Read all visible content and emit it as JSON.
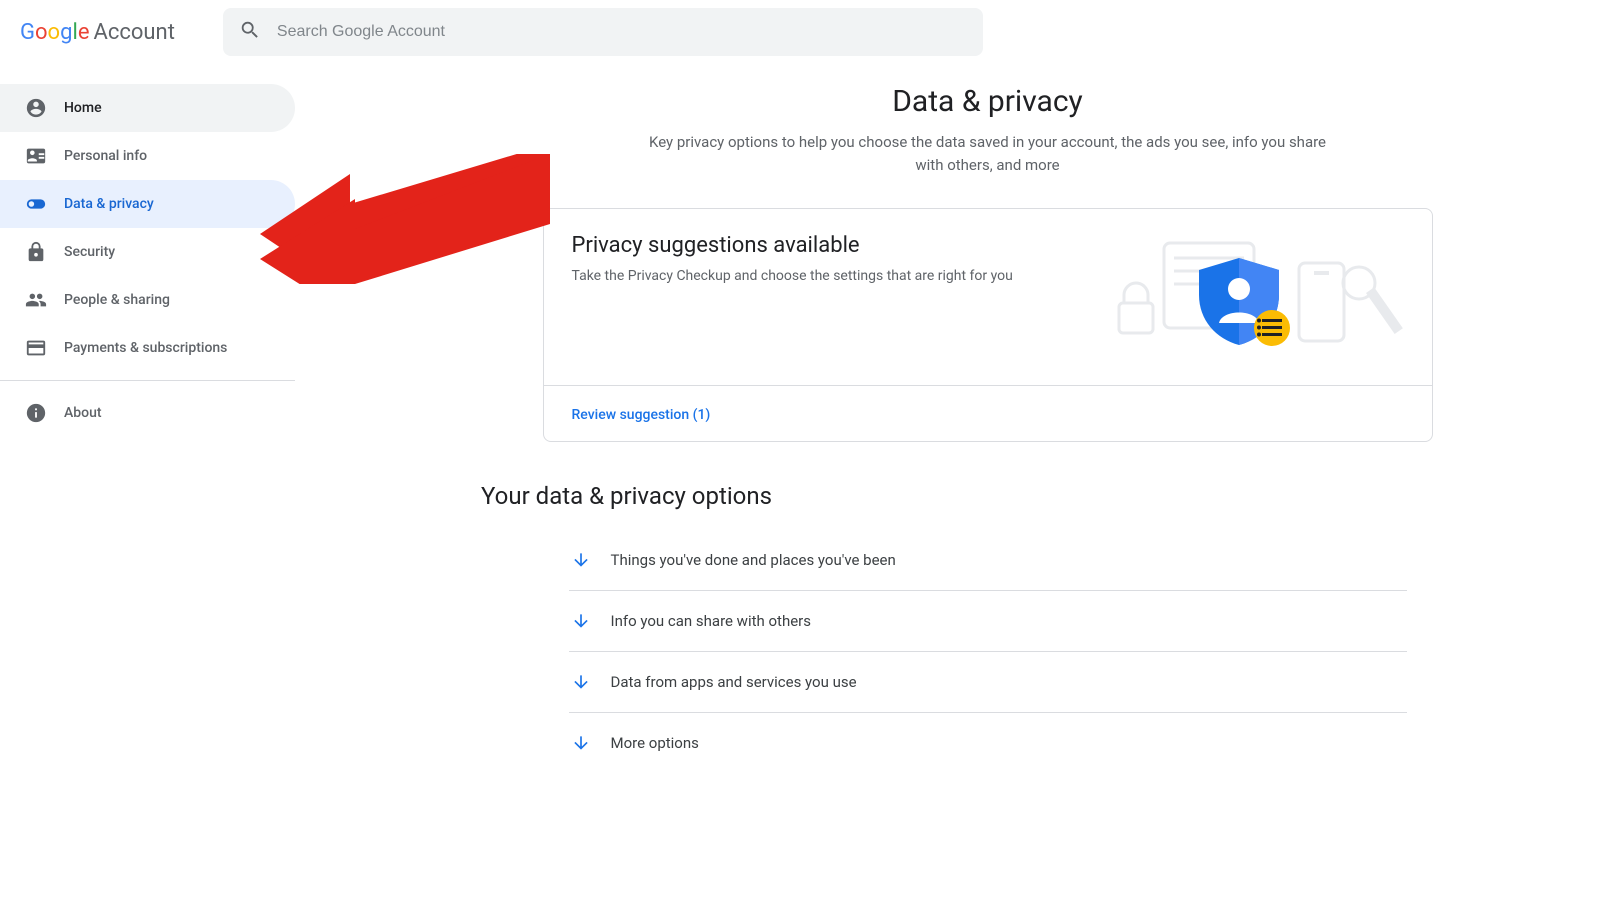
{
  "header": {
    "logo_account": "Account",
    "search_placeholder": "Search Google Account"
  },
  "sidebar": {
    "items": [
      {
        "label": "Home",
        "icon": "home"
      },
      {
        "label": "Personal info",
        "icon": "badge"
      },
      {
        "label": "Data & privacy",
        "icon": "toggle"
      },
      {
        "label": "Security",
        "icon": "lock"
      },
      {
        "label": "People & sharing",
        "icon": "people"
      },
      {
        "label": "Payments & subscriptions",
        "icon": "card"
      }
    ],
    "footer": {
      "label": "About",
      "icon": "info"
    }
  },
  "main": {
    "title": "Data & privacy",
    "subtitle": "Key privacy options to help you choose the data saved in your account, the ads you see, info you share with others, and more",
    "card": {
      "title": "Privacy suggestions available",
      "desc": "Take the Privacy Checkup and choose the settings that are right for you",
      "action": "Review suggestion (1)"
    },
    "options_heading": "Your data & privacy options",
    "options": [
      {
        "label": "Things you've done and places you've been"
      },
      {
        "label": "Info you can share with others"
      },
      {
        "label": "Data from apps and services you use"
      },
      {
        "label": "More options"
      }
    ]
  }
}
